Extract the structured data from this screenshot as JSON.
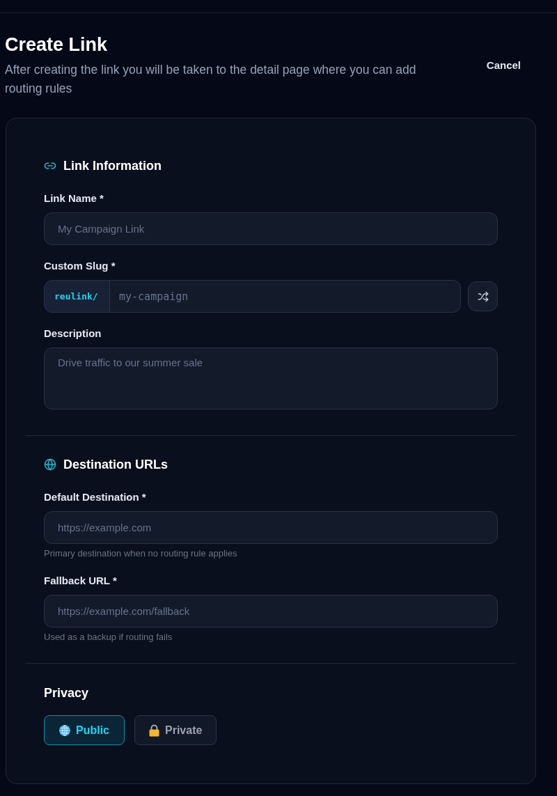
{
  "page": {
    "title": "Create Link",
    "subtitle": "After creating the link you will be taken to the detail page where you can add routing rules",
    "cancel_button": "Cancel"
  },
  "sections": [
    {
      "kind": "fields",
      "title": "Link Information",
      "fields": [
        {
          "kind": "text",
          "label": "Link Name *",
          "placeholder": "My Campaign Link"
        },
        {
          "kind": "slug",
          "label": "Custom Slug *",
          "prefix": "reulink/",
          "placeholder": "my-campaign"
        },
        {
          "kind": "textarea",
          "label": "Description",
          "placeholder": "Drive traffic to our summer sale"
        }
      ]
    },
    {
      "kind": "fields",
      "title": "Destination URLs",
      "fields": [
        {
          "kind": "text",
          "label": "Default Destination *",
          "placeholder": "https://example.com",
          "help_text": "Primary destination when no routing rule applies"
        },
        {
          "kind": "text",
          "label": "Fallback URL *",
          "placeholder": "https://example.com/fallback",
          "help_text": "Used as a backup if routing fails"
        }
      ]
    },
    {
      "kind": "choice",
      "title": "Privacy",
      "options": [
        {
          "label": "Public",
          "selected": true
        },
        {
          "label": "Private",
          "selected": false
        }
      ]
    }
  ]
}
